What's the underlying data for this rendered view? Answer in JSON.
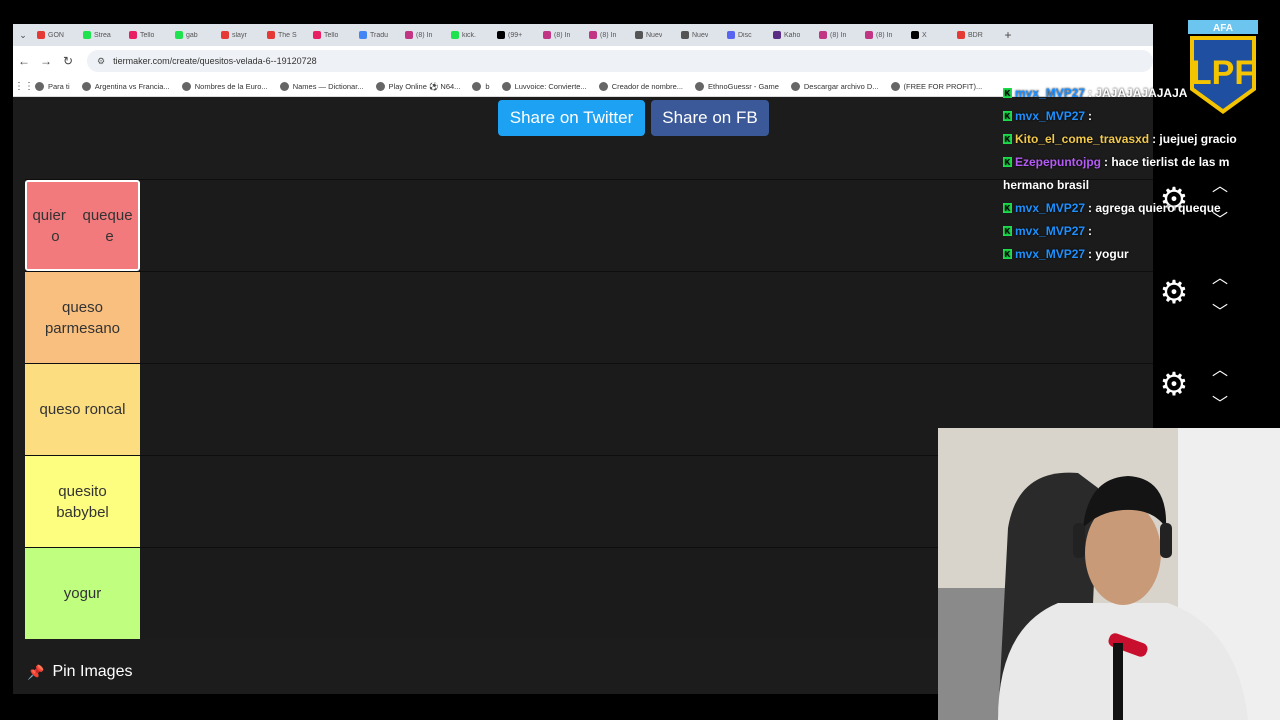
{
  "tabs": [
    "GON",
    "Strea",
    "Tello",
    "gab",
    "slayr",
    "The S",
    "Tello",
    "Tradu",
    "(8) In",
    "kick.",
    "(99+",
    "(8) In",
    "(8) In",
    "Nuev",
    "Nuev",
    "Disc",
    "Kaho",
    "(8) In",
    "(8) In",
    "X",
    "BDR"
  ],
  "tab_colors": [
    "#e53935",
    "#1ee34e",
    "#e91e63",
    "#1ee34e",
    "#e53935",
    "#e53935",
    "#e91e63",
    "#4285f4",
    "#c13584",
    "#1ee34e",
    "#000000",
    "#c13584",
    "#c13584",
    "#555555",
    "#555555",
    "#5865f2",
    "#5b2c83",
    "#c13584",
    "#c13584",
    "#000000",
    "#e53935"
  ],
  "address": {
    "url": "tiermaker.com/create/quesitos-velada-6--19120728"
  },
  "bookmarks": [
    "Para ti",
    "Argentina vs Francia...",
    "Nombres de la Euro...",
    "Names — Dictionar...",
    "Play Online ⚽ N64...",
    "b",
    "Luvvoice: Convierte...",
    "Creador de nombre...",
    "EthnoGuessr - Game",
    "Descargar archivo D...",
    "(FREE FOR PROFIT)..."
  ],
  "share": {
    "twitter": "Share on Twitter",
    "fb": "Share on FB"
  },
  "tiers": [
    {
      "label": "quier o queque",
      "line1": "quier    queque",
      "line2": "o           e",
      "color": "#f27a7d"
    },
    {
      "label": "queso parmesano",
      "line1": "queso",
      "line2": "parmesano",
      "color": "#f9bf7f"
    },
    {
      "label": "queso roncal",
      "line1": "queso roncal",
      "line2": "",
      "color": "#fcdd7f"
    },
    {
      "label": "quesito babybel",
      "line1": "quesito",
      "line2": "babybel",
      "color": "#fdfd7f"
    },
    {
      "label": "yogur",
      "line1": "yogur",
      "line2": "",
      "color": "#bffe7f"
    }
  ],
  "pin_images": "Pin Images",
  "chat": [
    {
      "user": "mvx_MVP27",
      "msg": ": JAJAJAJAJAJA",
      "color": "#1e90ff"
    },
    {
      "user": "mvx_MVP27",
      "msg": ":",
      "color": "#1e90ff"
    },
    {
      "user": "Kito_el_come_travasxd",
      "msg": ": juejuej  gracio",
      "color": "#f2c94c"
    },
    {
      "user": "Ezepepuntojpg",
      "msg": ": hace tierlist de las m",
      "color": "#b45cf5"
    },
    {
      "user": "",
      "msg": "hermano brasil",
      "color": "#ffffff"
    },
    {
      "user": "mvx_MVP27",
      "msg": ": agrega quiero queque",
      "color": "#1e90ff"
    },
    {
      "user": "mvx_MVP27",
      "msg": ":",
      "color": "#1e90ff"
    },
    {
      "user": "mvx_MVP27",
      "msg": ": yogur",
      "color": "#1e90ff"
    }
  ],
  "logo_text": "AFA"
}
